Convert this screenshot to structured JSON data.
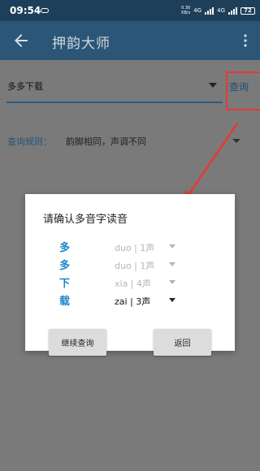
{
  "status_bar": {
    "time": "09:54",
    "net_speed_value": "0.30",
    "net_speed_unit": "KB/s",
    "network_1": "4G",
    "network_2": "4G",
    "battery": "72"
  },
  "app_bar": {
    "title": "押韵大师"
  },
  "search": {
    "value": "多多下载",
    "button_label": "查询"
  },
  "rules": {
    "label": "查询规则：",
    "value": "韵脚相同，声调不同"
  },
  "dialog": {
    "title": "请确认多音字读音",
    "rows": [
      {
        "char": "多",
        "pinyin": "duo | 1声",
        "enabled": false
      },
      {
        "char": "多",
        "pinyin": "duo | 1声",
        "enabled": false
      },
      {
        "char": "下",
        "pinyin": "xia | 4声",
        "enabled": false
      },
      {
        "char": "载",
        "pinyin": "zai | 3声",
        "enabled": true
      }
    ],
    "continue_label": "继续查询",
    "back_label": "返回"
  },
  "colors": {
    "status_bar": "#1e3f59",
    "app_bar": "#2b5677",
    "accent": "#1a86c8",
    "highlight": "#e53935"
  }
}
